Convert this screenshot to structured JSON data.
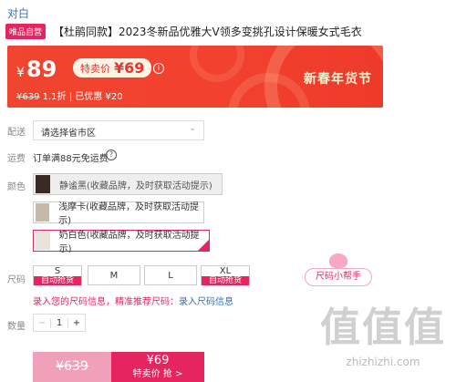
{
  "brand": "对白",
  "product": {
    "tag": "唯品自营",
    "title": "【杜鹃同款】2023冬新品优雅大V领多变挑孔设计保暖女式毛衣"
  },
  "price": {
    "currency": "¥",
    "main": "89",
    "special_label": "特卖价",
    "special_price": "¥69",
    "info_icon": "info-icon",
    "original": "¥639",
    "discount": "1.1折",
    "saved": "已优惠 ¥20",
    "festival": "新春年货节"
  },
  "delivery": {
    "label": "配送",
    "placeholder": "请选择省市区"
  },
  "shipping": {
    "label": "运费",
    "text": "订单满88元免运费"
  },
  "color": {
    "label": "颜色",
    "options": [
      {
        "name": "静谧黑(收藏品牌，及时获取活动提示)",
        "state": "disabled",
        "swatch": "#3a2a24"
      },
      {
        "name": "浅摩卡(收藏品牌，及时获取活动提示)",
        "state": "normal",
        "swatch": "#c7b9a8"
      },
      {
        "name": "奶白色(收藏品牌，及时获取活动提示)",
        "state": "selected",
        "swatch": "#e9e3dc"
      }
    ]
  },
  "size": {
    "label": "尺码",
    "options": [
      {
        "name": "S",
        "flag": "自动抢货"
      },
      {
        "name": "M",
        "flag": ""
      },
      {
        "name": "L",
        "flag": ""
      },
      {
        "name": "XL",
        "flag": "自动抢货"
      }
    ],
    "helper": "尺码小帮手",
    "note": "录入您的尺码信息，精准推荐尺码：",
    "note_link": "录入尺码信息"
  },
  "quantity": {
    "label": "数量",
    "minus": "−",
    "value": "1",
    "plus": "+"
  },
  "buy": {
    "left_price": "¥639",
    "right_price": "¥69",
    "right_label": "特卖价 抢 >"
  },
  "watermark": {
    "glyphs": "值值值",
    "site": "zhizhizhi.com"
  }
}
